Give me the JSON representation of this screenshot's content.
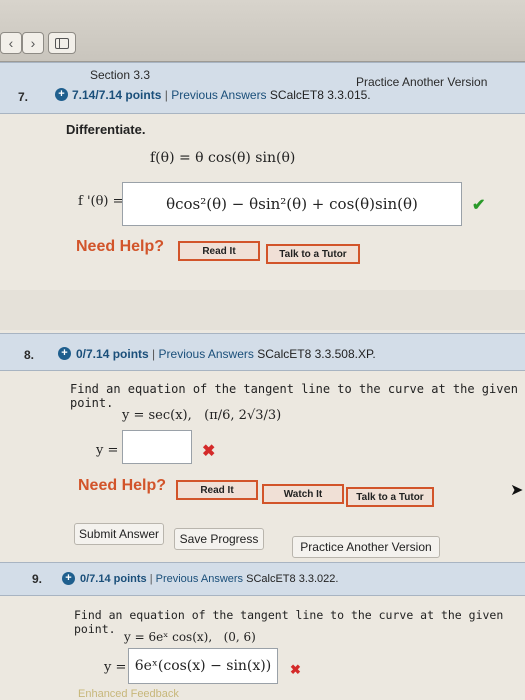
{
  "q7": {
    "section": "Section 3.3",
    "practice_link": "Practice Another Version",
    "number": "7.",
    "points": "7.14/7.14 points",
    "separator": "|",
    "previous_answers": "Previous Answers",
    "source": "SCalcET8 3.3.015.",
    "prompt": "Differentiate.",
    "function": "f(θ) = θ cos(θ) sin(θ)",
    "answer_label": "f '(θ) =",
    "answer_value": "θcos²(θ) − θsin²(θ) + cos(θ)sin(θ)",
    "status_icon": "checkmark-icon",
    "need_help": "Need Help?",
    "buttons": [
      "Read It",
      "Talk to a Tutor"
    ]
  },
  "q8": {
    "number": "8.",
    "points": "0/7.14 points",
    "separator": "|",
    "previous_answers": "Previous Answers",
    "source": "SCalcET8 3.3.508.XP.",
    "prompt": "Find an equation of the tangent line to the curve at the given point.",
    "equation": "y = sec(x),   (π/6, 2√3/3)",
    "answer_label": "y =",
    "answer_value": "",
    "status_icon": "x-icon",
    "need_help": "Need Help?",
    "buttons": [
      "Read It",
      "Watch It",
      "Talk to a Tutor"
    ],
    "actions": [
      "Submit Answer",
      "Save Progress",
      "Practice Another Version"
    ]
  },
  "q9": {
    "number": "9.",
    "points": "0/7.14 points",
    "separator": "|",
    "previous_answers": "Previous Answers",
    "source": "SCalcET8 3.3.022.",
    "prompt": "Find an equation of the tangent line to the curve at the given point.",
    "equation": "y = 6eˣ cos(x),   (0, 6)",
    "answer_label": "y =",
    "answer_value": "6eˣ(cos(x) − sin(x))",
    "status_icon": "x-icon",
    "footer_text": "Enhanced Feedback"
  },
  "colors": {
    "header_bg": "#d3dde8",
    "link": "#1a4f7a",
    "need_help": "#d2542a",
    "correct": "#2a9a2a",
    "incorrect": "#d42a2a"
  }
}
